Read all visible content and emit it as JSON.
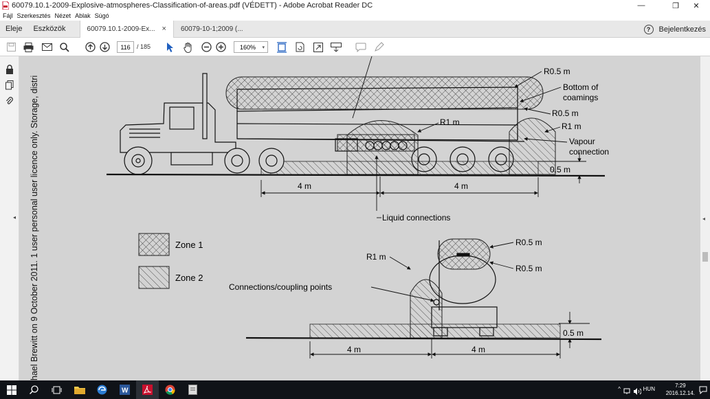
{
  "window": {
    "title": "60079.10.1-2009-Explosive-atmospheres-Classification-of-areas.pdf (VÉDETT) - Adobe Acrobat Reader DC",
    "minimize": "—",
    "maximize": "❐",
    "close": "✕"
  },
  "menu": [
    "Fájl",
    "Szerkesztés",
    "Nézet",
    "Ablak",
    "Súgó"
  ],
  "tabbar": {
    "home": "Eleje",
    "tools": "Eszközök",
    "tabs": [
      {
        "label": "60079.10.1-2009-Ex...",
        "close": "×"
      },
      {
        "label": "60079-10-1;2009 (..."
      }
    ],
    "help": "?",
    "signin": "Bejelentkezés"
  },
  "toolbar": {
    "page_current": "116",
    "page_total": "/ 185",
    "zoom": "160%",
    "zoom_arrow": "▾"
  },
  "watermark": "hael Brewitt on 9 October 2011. 1  user personal user licence only. Storage, distri",
  "figure": {
    "top": {
      "r05_a": "R0.5 m",
      "bottom_of": "Bottom of",
      "coamings": "coamings",
      "r05_b": "R0.5 m",
      "r1_a": "R1 m",
      "r1_b": "R1 m",
      "vapour": "Vapour",
      "connection": "connection",
      "dim_05": "0.5 m",
      "dim_4a": "4 m",
      "dim_4b": "4 m",
      "liquid": "Liquid connections"
    },
    "legend": {
      "zone1": "Zone 1",
      "zone2": "Zone 2"
    },
    "bottom": {
      "r05_a": "R0.5 m",
      "r05_b": "R0.5 m",
      "r1": "R1 m",
      "coupling": "Connections/coupling points",
      "dim_05": "0.5 m",
      "dim_4a": "4 m",
      "dim_4b": "4 m"
    }
  },
  "taskbar": {
    "lang": "HUN",
    "time": "7:29",
    "date": "2016.12.14."
  },
  "colors": {
    "page_bg": "#d3d3d3",
    "taskbar": "#101318",
    "acrobat_red": "#c8102e"
  }
}
